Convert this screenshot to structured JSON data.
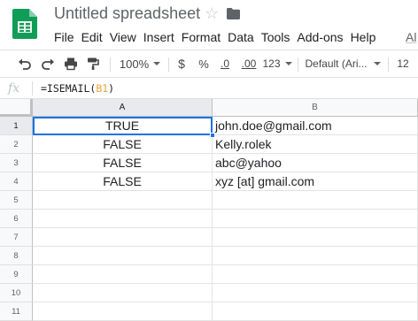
{
  "title": "Untitled spreadsheet",
  "menu": [
    "File",
    "Edit",
    "View",
    "Insert",
    "Format",
    "Data",
    "Tools",
    "Add-ons",
    "Help"
  ],
  "menu_cut_item": "Al",
  "toolbar": {
    "zoom": "100%",
    "currency": "$",
    "percent": "%",
    "decrease_decimal": ".0",
    "increase_decimal": ".00",
    "more_formats": "123",
    "font": "Default (Ari...",
    "font_size": "12"
  },
  "formula_bar": {
    "label": "fx",
    "formula_prefix": "=ISEMAIL(",
    "formula_ref": "B1",
    "formula_suffix": ")"
  },
  "columns": [
    "A",
    "B"
  ],
  "rows": [
    {
      "num": "1",
      "a": "TRUE",
      "b": "john.doe@gmail.com"
    },
    {
      "num": "2",
      "a": "FALSE",
      "b": "Kelly.rolek"
    },
    {
      "num": "3",
      "a": "FALSE",
      "b": "abc@yahoo"
    },
    {
      "num": "4",
      "a": "FALSE",
      "b": "xyz [at] gmail.com"
    },
    {
      "num": "5",
      "a": "",
      "b": ""
    },
    {
      "num": "6",
      "a": "",
      "b": ""
    },
    {
      "num": "7",
      "a": "",
      "b": ""
    },
    {
      "num": "8",
      "a": "",
      "b": ""
    },
    {
      "num": "9",
      "a": "",
      "b": ""
    },
    {
      "num": "10",
      "a": "",
      "b": ""
    },
    {
      "num": "11",
      "a": "",
      "b": ""
    }
  ],
  "colors": {
    "accent": "#1a73e8",
    "sheets_green": "#0f9d58",
    "ref_orange": "#e8a33d"
  },
  "icons": [
    "sheets-logo-icon",
    "star-icon",
    "folder-icon",
    "undo-icon",
    "redo-icon",
    "print-icon",
    "paint-format-icon",
    "caret-down-icon"
  ]
}
